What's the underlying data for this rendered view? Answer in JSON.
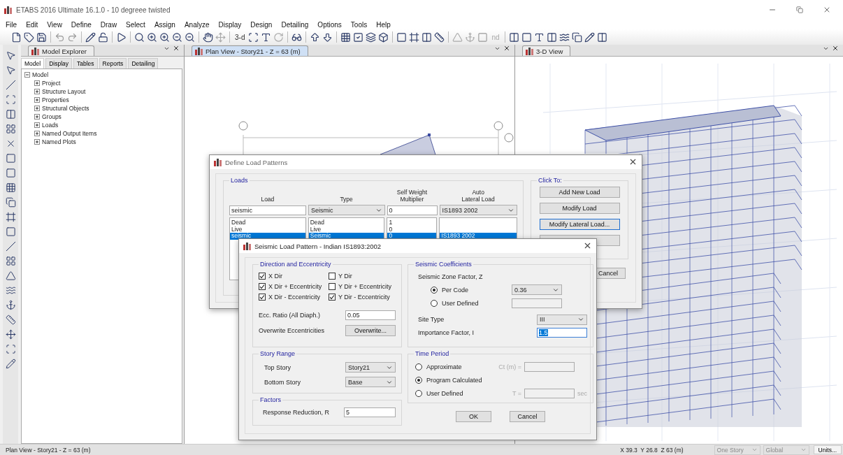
{
  "window": {
    "title": "ETABS 2016 Ultimate 16.1.0 - 10 degreee twisted"
  },
  "menu": [
    "File",
    "Edit",
    "View",
    "Define",
    "Draw",
    "Select",
    "Assign",
    "Analyze",
    "Display",
    "Design",
    "Detailing",
    "Options",
    "Tools",
    "Help"
  ],
  "toolbar_labels": [
    {
      "label": "3-d",
      "disabled": false
    },
    {
      "label": "nd",
      "disabled": true
    }
  ],
  "model_explorer": {
    "title": "Model Explorer",
    "tabs": [
      {
        "label": "Model",
        "selected": true
      },
      {
        "label": "Display",
        "selected": false
      },
      {
        "label": "Tables",
        "selected": false
      },
      {
        "label": "Reports",
        "selected": false
      },
      {
        "label": "Detailing",
        "selected": false
      }
    ],
    "tree": {
      "label": "Model",
      "expanded": true,
      "children": [
        {
          "label": "Project",
          "expanded": false
        },
        {
          "label": "Structure Layout",
          "expanded": false
        },
        {
          "label": "Properties",
          "expanded": false
        },
        {
          "label": "Structural Objects",
          "expanded": false
        },
        {
          "label": "Groups",
          "expanded": false
        },
        {
          "label": "Loads",
          "expanded": false
        },
        {
          "label": "Named Output Items",
          "expanded": false
        },
        {
          "label": "Named Plots",
          "expanded": false
        }
      ]
    }
  },
  "plan_view": {
    "tab": "Plan View - Story21 - Z = 63 (m)",
    "selected": true
  },
  "view_3d": {
    "tab": "3-D View",
    "selected": false
  },
  "define_load_patterns": {
    "title": "Define Load Patterns",
    "loads": {
      "title": "Loads",
      "columns": [
        {
          "lines": [
            "Load"
          ]
        },
        {
          "lines": [
            "Type"
          ]
        },
        {
          "lines": [
            "Self Weight",
            "Multiplier"
          ]
        },
        {
          "lines": [
            "Auto",
            "Lateral Load"
          ]
        }
      ],
      "edit_row": {
        "load": "seismic",
        "type": "Seismic",
        "multiplier": "0",
        "auto": "IS1893 2002"
      },
      "rows": [
        {
          "load": "Dead",
          "type": "Dead",
          "multiplier": "1",
          "selected": false
        },
        {
          "load": "Live",
          "type": "Live",
          "multiplier": "0",
          "selected": false
        },
        {
          "load": "seismic",
          "type": "Seismic",
          "multiplier": "0",
          "auto": "IS1893 2002",
          "selected": true
        }
      ]
    },
    "click_to": {
      "title": "Click To:",
      "buttons": [
        {
          "label": "Add New Load",
          "focused": false
        },
        {
          "label": "Modify Load",
          "focused": false
        },
        {
          "label": "Modify Lateral Load...",
          "focused": true
        }
      ]
    },
    "cancel": "Cancel"
  },
  "seismic_load_pattern": {
    "title": "Seismic Load Pattern - Indian IS1893:2002",
    "direction": {
      "title": "Direction and Eccentricity",
      "checks": [
        {
          "label": "X Dir",
          "checked": true
        },
        {
          "label": "Y Dir",
          "checked": false
        },
        {
          "label": "X Dir + Eccentricity",
          "checked": true
        },
        {
          "label": "Y Dir + Eccentricity",
          "checked": false
        },
        {
          "label": "X Dir - Eccentricity",
          "checked": true
        },
        {
          "label": "Y Dir - Eccentricity",
          "checked": true
        }
      ],
      "ecc_ratio": {
        "label": "Ecc. Ratio (All Diaph.)",
        "value": "0.05"
      },
      "overwrite": {
        "label": "Overwrite Eccentricities",
        "button": "Overwrite..."
      }
    },
    "story_range": {
      "title": "Story Range",
      "top": {
        "label": "Top Story",
        "value": "Story21"
      },
      "bottom": {
        "label": "Bottom Story",
        "value": "Base"
      }
    },
    "factors": {
      "title": "Factors",
      "response_reduction": {
        "label": "Response Reduction, R",
        "value": "5"
      }
    },
    "coefficients": {
      "title": "Seismic Coefficients",
      "zone_label": "Seismic Zone Factor, Z",
      "zone_options": [
        {
          "label": "Per Code",
          "selected": true,
          "kind": "dropdown",
          "value": "0.36"
        },
        {
          "label": "User Defined",
          "selected": false,
          "kind": "field"
        }
      ],
      "site_type": {
        "label": "Site Type",
        "value": "III"
      },
      "importance": {
        "label": "Importance Factor, I",
        "value": "1.5",
        "text_selected": true
      }
    },
    "time_period": {
      "title": "Time Period",
      "options": [
        {
          "label": "Approximate",
          "selected": false,
          "kind": "field",
          "field_label": "Ct (m) ="
        },
        {
          "label": "Program Calculated",
          "selected": true,
          "kind": "plain"
        },
        {
          "label": "User Defined",
          "selected": false,
          "kind": "field",
          "field_label": "T =",
          "unit": "sec"
        }
      ]
    },
    "buttons": [
      "OK",
      "Cancel"
    ]
  },
  "status_bar": {
    "left": "Plan View - Story21 - Z = 63 (m)",
    "coords": "X 39.3  Y 26.8  Z 63 (m)",
    "dropdowns": [
      "One Story",
      "Global"
    ],
    "button": "Units..."
  }
}
